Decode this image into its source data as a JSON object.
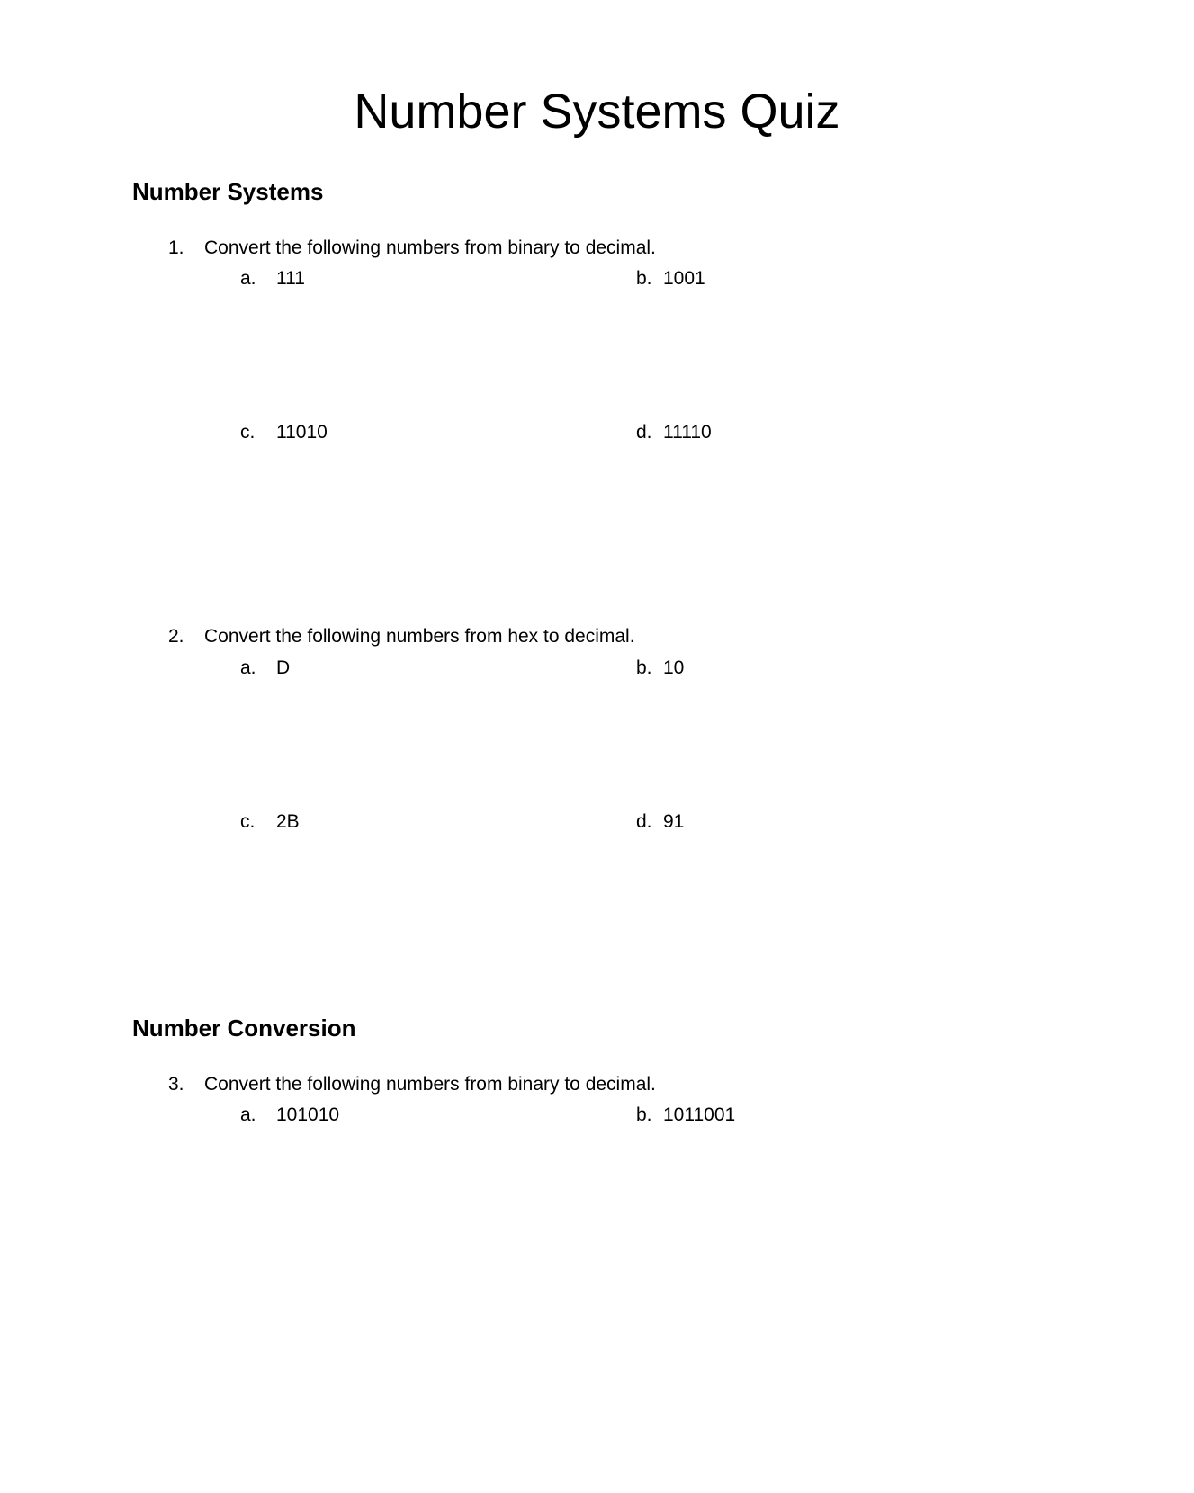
{
  "title": "Number Systems Quiz",
  "sections": [
    {
      "heading": "Number Systems",
      "questions": [
        {
          "number": "1.",
          "prompt": "Convert the following numbers from binary to decimal.",
          "options": [
            {
              "letter": "a.",
              "value": "111"
            },
            {
              "letter": "b.",
              "value": "1001"
            },
            {
              "letter": "c.",
              "value": "11010"
            },
            {
              "letter": "d.",
              "value": "11110"
            }
          ]
        },
        {
          "number": "2.",
          "prompt": "Convert the following numbers from hex to decimal.",
          "options": [
            {
              "letter": "a.",
              "value": "D"
            },
            {
              "letter": "b.",
              "value": "10"
            },
            {
              "letter": "c.",
              "value": "2B"
            },
            {
              "letter": "d.",
              "value": "91"
            }
          ]
        }
      ]
    },
    {
      "heading": "Number Conversion",
      "questions": [
        {
          "number": "3.",
          "prompt": "Convert the following numbers from binary to decimal.",
          "options": [
            {
              "letter": "a.",
              "value": "101010"
            },
            {
              "letter": "b.",
              "value": "1011001"
            }
          ]
        }
      ]
    }
  ]
}
